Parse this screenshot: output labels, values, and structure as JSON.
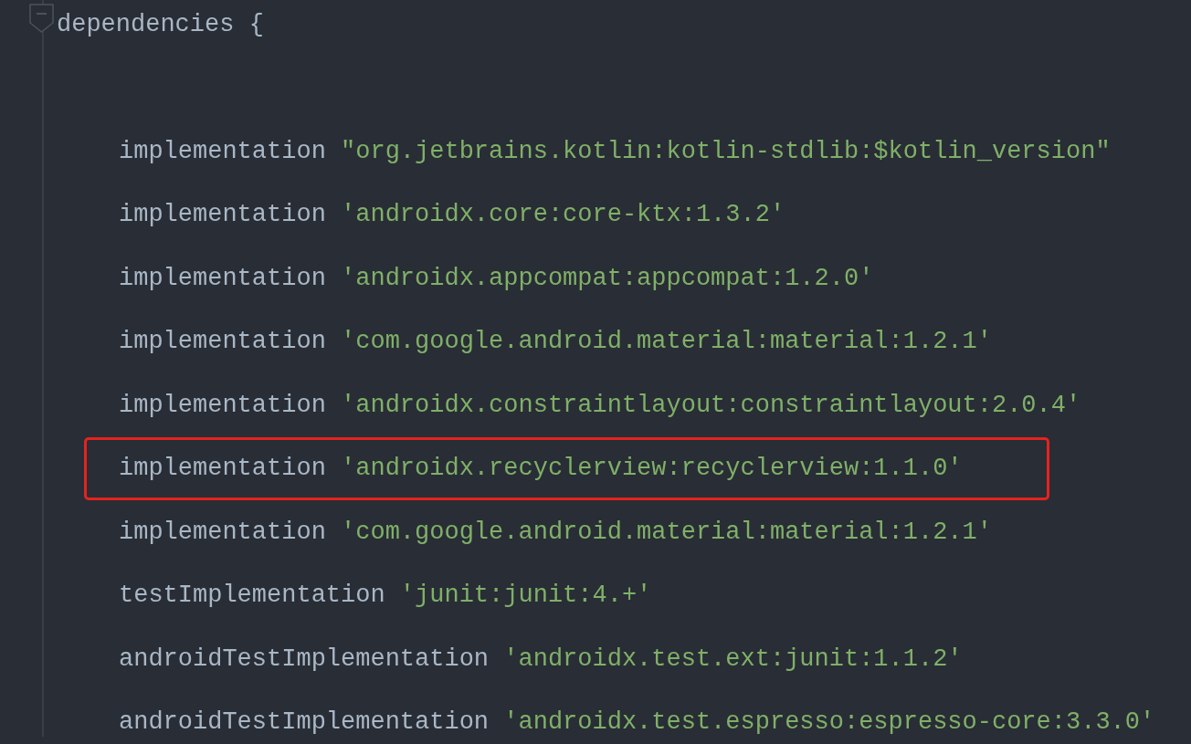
{
  "block": {
    "keyword": "dependencies",
    "brace": "{",
    "expanded": true
  },
  "lines": [
    {
      "method": "implementation",
      "argument": "\"org.jetbrains.kotlin:kotlin-stdlib:$kotlin_version\"",
      "highlighted": false
    },
    {
      "method": "implementation",
      "argument": "'androidx.core:core-ktx:1.3.2'",
      "highlighted": false
    },
    {
      "method": "implementation",
      "argument": "'androidx.appcompat:appcompat:1.2.0'",
      "highlighted": false
    },
    {
      "method": "implementation",
      "argument": "'com.google.android.material:material:1.2.1'",
      "highlighted": false
    },
    {
      "method": "implementation",
      "argument": "'androidx.constraintlayout:constraintlayout:2.0.4'",
      "highlighted": false
    },
    {
      "method": "implementation",
      "argument": "'androidx.recyclerview:recyclerview:1.1.0'",
      "highlighted": true
    },
    {
      "method": "implementation",
      "argument": "'com.google.android.material:material:1.2.1'",
      "highlighted": false
    },
    {
      "method": "testImplementation",
      "argument": "'junit:junit:4.+'",
      "highlighted": false
    },
    {
      "method": "androidTestImplementation",
      "argument": "'androidx.test.ext:junit:1.1.2'",
      "highlighted": false
    },
    {
      "method": "androidTestImplementation",
      "argument": "'androidx.test.espresso:espresso-core:3.3.0'",
      "highlighted": false
    }
  ]
}
